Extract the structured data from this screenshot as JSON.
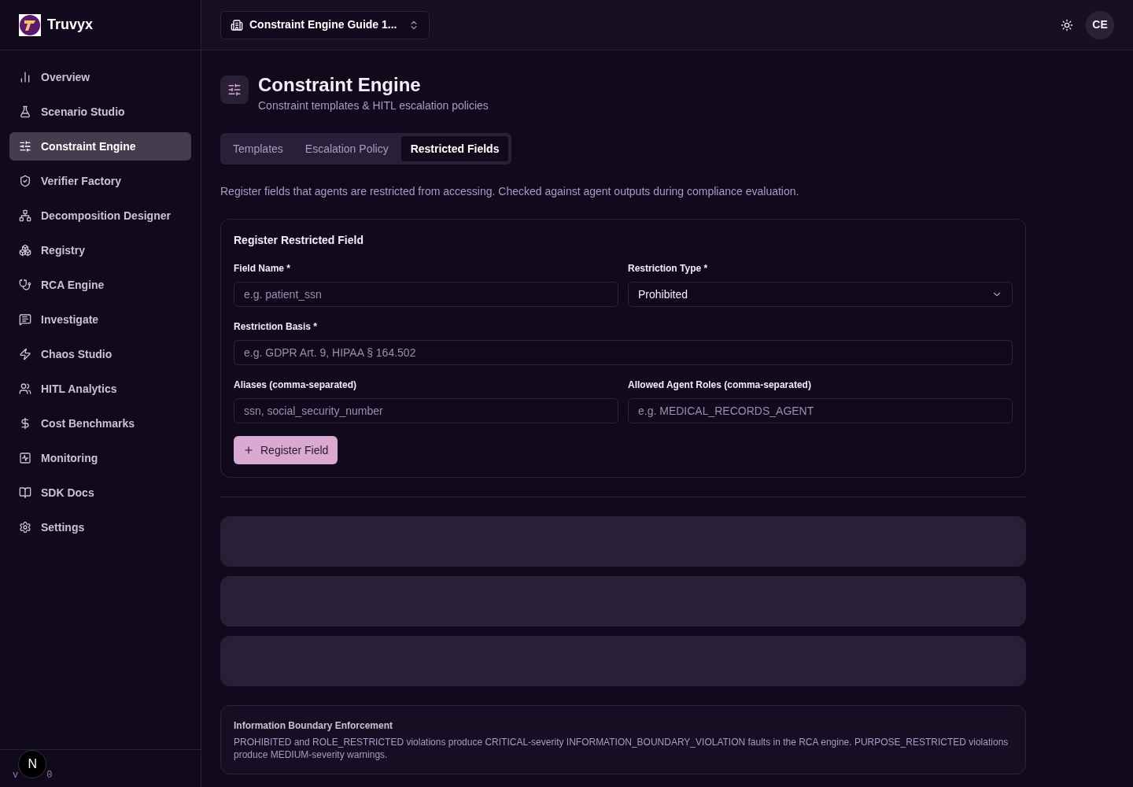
{
  "brand": {
    "name": "Truvyx"
  },
  "sidebar": {
    "items": [
      {
        "label": "Overview",
        "selected": false
      },
      {
        "label": "Scenario Studio",
        "selected": false
      },
      {
        "label": "Constraint Engine",
        "selected": true
      },
      {
        "label": "Verifier Factory",
        "selected": false
      },
      {
        "label": "Decomposition Designer",
        "selected": false
      },
      {
        "label": "Registry",
        "selected": false
      },
      {
        "label": "RCA Engine",
        "selected": false
      },
      {
        "label": "Investigate",
        "selected": false
      },
      {
        "label": "Chaos Studio",
        "selected": false
      },
      {
        "label": "HITL Analytics",
        "selected": false
      },
      {
        "label": "Cost Benchmarks",
        "selected": false
      },
      {
        "label": "Monitoring",
        "selected": false
      },
      {
        "label": "SDK Docs",
        "selected": false
      },
      {
        "label": "Settings",
        "selected": false
      }
    ],
    "version_parts": [
      "v",
      "0"
    ],
    "dev_badge": "N"
  },
  "header": {
    "workspace": "Constraint Engine Guide 1...",
    "avatar": "CE"
  },
  "page": {
    "title": "Constraint Engine",
    "subtitle": "Constraint templates & HITL escalation policies"
  },
  "tabs": [
    {
      "label": "Templates",
      "selected": false
    },
    {
      "label": "Escalation Policy",
      "selected": false
    },
    {
      "label": "Restricted Fields",
      "selected": true
    }
  ],
  "description": "Register fields that agents are restricted from accessing. Checked against agent outputs during compliance evaluation.",
  "form": {
    "title": "Register Restricted Field",
    "rows": [
      [
        {
          "kind": "input",
          "label": "Field Name *",
          "placeholder": "e.g. patient_ssn"
        },
        {
          "kind": "select",
          "label": "Restriction Type *",
          "value": "Prohibited"
        }
      ],
      [
        {
          "kind": "input",
          "label": "Restriction Basis *",
          "placeholder": "e.g. GDPR Art. 9, HIPAA § 164.502"
        }
      ],
      [
        {
          "kind": "input",
          "label": "Aliases (comma-separated)",
          "placeholder": "ssn, social_security_number"
        },
        {
          "kind": "input",
          "label": "Allowed Agent Roles (comma-separated)",
          "placeholder": "e.g. MEDICAL_RECORDS_AGENT"
        }
      ]
    ],
    "submit": "Register Field"
  },
  "loading_rows": [
    {
      "kind": "skeleton"
    },
    {
      "kind": "skeleton"
    },
    {
      "kind": "skeleton"
    }
  ],
  "info": {
    "title": "Information Boundary Enforcement",
    "text": "PROHIBITED and ROLE_RESTRICTED violations produce CRITICAL-severity INFORMATION_BOUNDARY_VIOLATION faults in the RCA engine. PURPOSE_RESTRICTED violations produce MEDIUM-severity warnings."
  }
}
